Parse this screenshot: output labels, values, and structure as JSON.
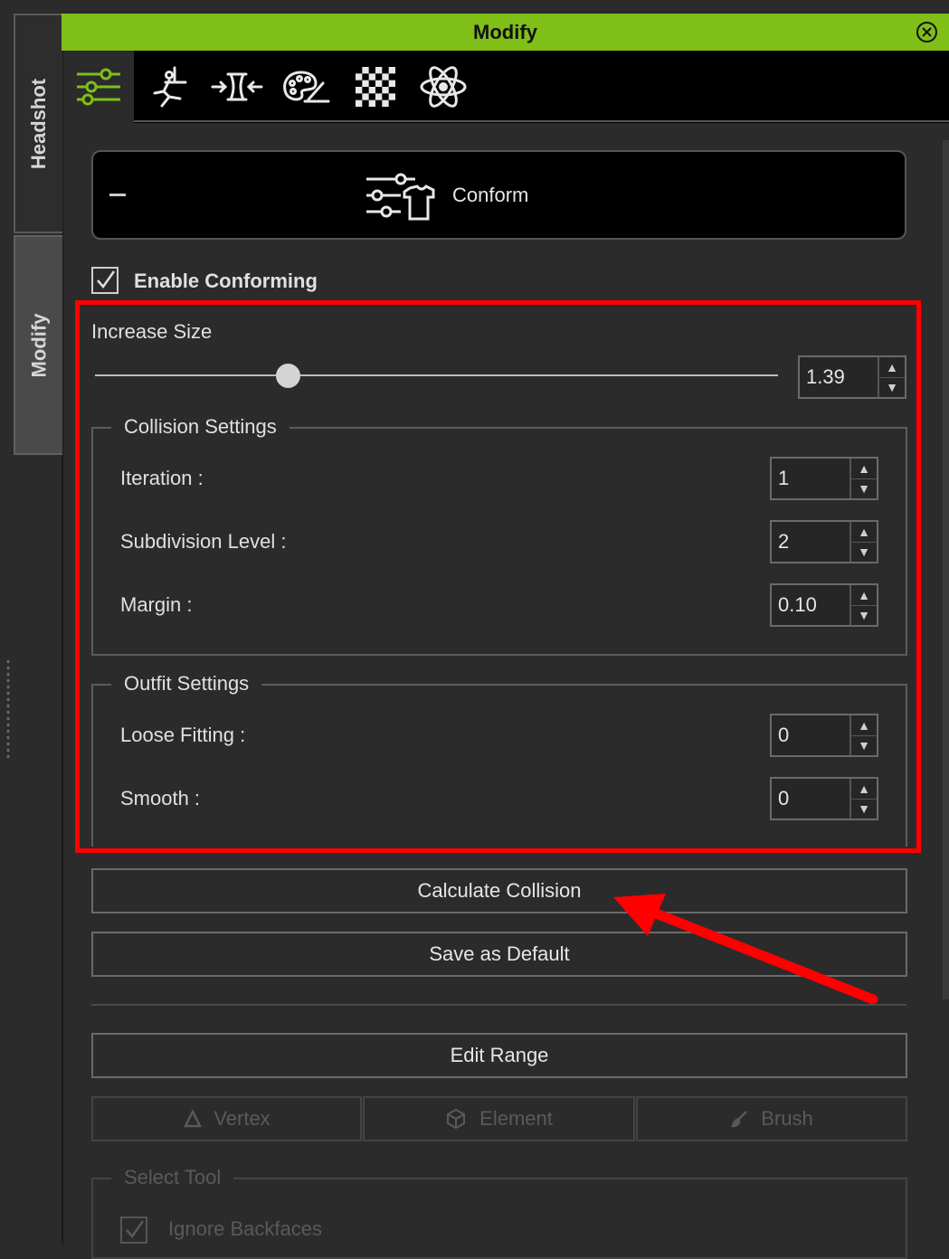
{
  "side_tabs": {
    "headshot": "Headshot",
    "modify": "Modify"
  },
  "window": {
    "title": "Modify"
  },
  "toolbar": {
    "tools": [
      "sliders-icon",
      "pose-icon",
      "conform-fit-icon",
      "palette-icon",
      "checker-icon",
      "atom-icon"
    ],
    "active_index": 0
  },
  "conform_section": {
    "label": "Conform"
  },
  "enable_conforming": {
    "label": "Enable Conforming",
    "checked": true
  },
  "increase_size": {
    "label": "Increase Size",
    "value": "1.39",
    "slider_fraction": 0.28
  },
  "collision_settings": {
    "legend": "Collision Settings",
    "iteration": {
      "label": "Iteration :",
      "value": "1"
    },
    "subdivision": {
      "label": "Subdivision Level :",
      "value": "2"
    },
    "margin": {
      "label": "Margin :",
      "value": "0.10"
    }
  },
  "outfit_settings": {
    "legend": "Outfit Settings",
    "loose_fitting": {
      "label": "Loose Fitting :",
      "value": "0"
    },
    "smooth": {
      "label": "Smooth :",
      "value": "0"
    }
  },
  "buttons": {
    "calculate_collision": "Calculate Collision",
    "save_as_default": "Save as Default",
    "edit_range": "Edit Range"
  },
  "range_tools": {
    "vertex": "Vertex",
    "element": "Element",
    "brush": "Brush"
  },
  "select_tool": {
    "legend": "Select Tool",
    "ignore_backfaces": "Ignore Backfaces"
  },
  "colors": {
    "accent": "#7fbf18",
    "highlight": "#ff0000",
    "panel": "#2b2b2b"
  }
}
